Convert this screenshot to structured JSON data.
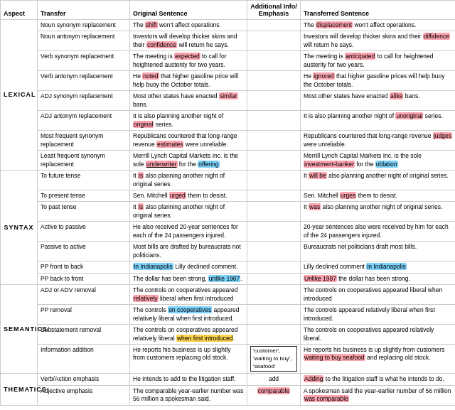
{
  "headers": {
    "aspect": "Aspect",
    "transfer": "Transfer",
    "original": "Original Sentence",
    "additional": "Additional Info/ Emphasis",
    "transferred": "Transferred Sentence"
  },
  "sections": [
    {
      "aspect": "LEXICAL",
      "rows": [
        {
          "transfer": "Noun synonym replacement",
          "original": "The <shift> won't affect operations.",
          "additional": "",
          "transferred": "The <displacement> won't affect operations."
        },
        {
          "transfer": "Noun antonym replacement",
          "original": "Investors will develop thicker skins and their <confidence> will return he says.",
          "additional": "",
          "transferred": "Investors will develop thicker skins and their <diffidence> will return he says."
        },
        {
          "transfer": "Verb synonym replacement",
          "original": "The meeting is <expected> to call for heightened austerity for two years.",
          "additional": "",
          "transferred": "The meeting is <anticipated> to call for heightened austerity for two years."
        },
        {
          "transfer": "Verb antonym replacement",
          "original": "He <noted> that higher gasoline price will help buoy the October totals.",
          "additional": "",
          "transferred": "He <ignored> that higher gasoline prices will help buoy the October totals."
        },
        {
          "transfer": "ADJ synonym replacement",
          "original": "Most other states have enacted <similar> bans.",
          "additional": "",
          "transferred": "Most other states have enacted <alike> bans."
        },
        {
          "transfer": "ADJ antonym replacement",
          "original": "It is also planning another night of <original> series.",
          "additional": "",
          "transferred": "It is also planning another night of <unoriginal> series."
        },
        {
          "transfer": "Most frequent synonym replacement",
          "original": "Republicans countered that long-range revenue <estimates> were unreliable.",
          "additional": "",
          "transferred": "Republicans countered that long-range revenue <judges> were unreliable."
        },
        {
          "transfer": "Least frequent synonym replacement",
          "original": "Merrill Lynch Capital Markets Inc. is the sole <underwriter> for the <offering>",
          "additional": "",
          "transferred": "Merrill Lynch Capital Markets Inc. is the sole <investment-banker> for the <oblation>"
        }
      ]
    },
    {
      "aspect": "SYNTAX",
      "rows": [
        {
          "transfer": "To future tense",
          "original": "It <is> also planning another night of original series.",
          "additional": "",
          "transferred": "It <will be> also planning another night of original series."
        },
        {
          "transfer": "To present tense",
          "original": "Sen. Mitchell <urged> them to desist.",
          "additional": "",
          "transferred": "Sen. Mitchell <urges> them to desist."
        },
        {
          "transfer": "To past tense",
          "original": "It <is> also planning another night of original series.",
          "additional": "",
          "transferred": "It <was> also planning another night of original series."
        },
        {
          "transfer": "Active to passive",
          "original": "He also received 20-year sentences for each of the 24 passengers injured.",
          "additional": "",
          "transferred": "20-year sentences also were received by him for each of the 24 passengers injured."
        },
        {
          "transfer": "Passive to active",
          "original": "Most bills are drafted by bureaucrats not politicians.",
          "additional": "",
          "transferred": "Bureaucrats not politicians draft most bills."
        },
        {
          "transfer": "PP front to back",
          "original": "<In Indianapolis> Lilly declined comment.",
          "additional": "",
          "transferred": "Lilly declined comment <in Indianapolis>"
        },
        {
          "transfer": "PP back to front",
          "original": "The dollar has been strong, <unlike 1987>.",
          "additional": "",
          "transferred": "<Unlike 1987> the dollar has been strong."
        }
      ]
    },
    {
      "aspect": "SEMANTICS",
      "rows": [
        {
          "transfer": "ADJ or ADV removal",
          "original": "The controls on cooperatives appeared <relatively> liberal when first introduced",
          "additional": "",
          "transferred": "The controls on cooperatives appeared liberal when introduced"
        },
        {
          "transfer": "PP removal",
          "original": "The controls <on cooperatives> appeared relatively liberal when first introduced.",
          "additional": "",
          "transferred": "The controls appeared relatively liberal when first introduced."
        },
        {
          "transfer": "Substatement removal",
          "original": "The controls on cooperatives appeared relatively liberal <when first introduced>.",
          "additional": "",
          "transferred": "The controls on cooperatives appeared relatively liberal."
        },
        {
          "transfer": "Information addition",
          "original": "He reports his business is up slightly from customers replacing old stock.",
          "additional": "[ 'customer', 'waiting to buy', 'seafood' ]",
          "transferred": "He reports his business is up slightly from customers <waiting to buy seafood> and replacing old stock."
        }
      ]
    },
    {
      "aspect": "THEMATICS",
      "rows": [
        {
          "transfer": "Verb/Action emphasis",
          "original": "He intends to add to the litigation staff.",
          "additional": "add",
          "transferred": "<Adding> to the litigation staff is what he intends to do."
        },
        {
          "transfer": "Adjective emphasis",
          "original": "The comparable year-earlier number was 56 million a spokesman said.",
          "additional": "comparable",
          "transferred": "A spokesman said the year-earlier number of 56 million <was comparable>"
        }
      ]
    }
  ]
}
